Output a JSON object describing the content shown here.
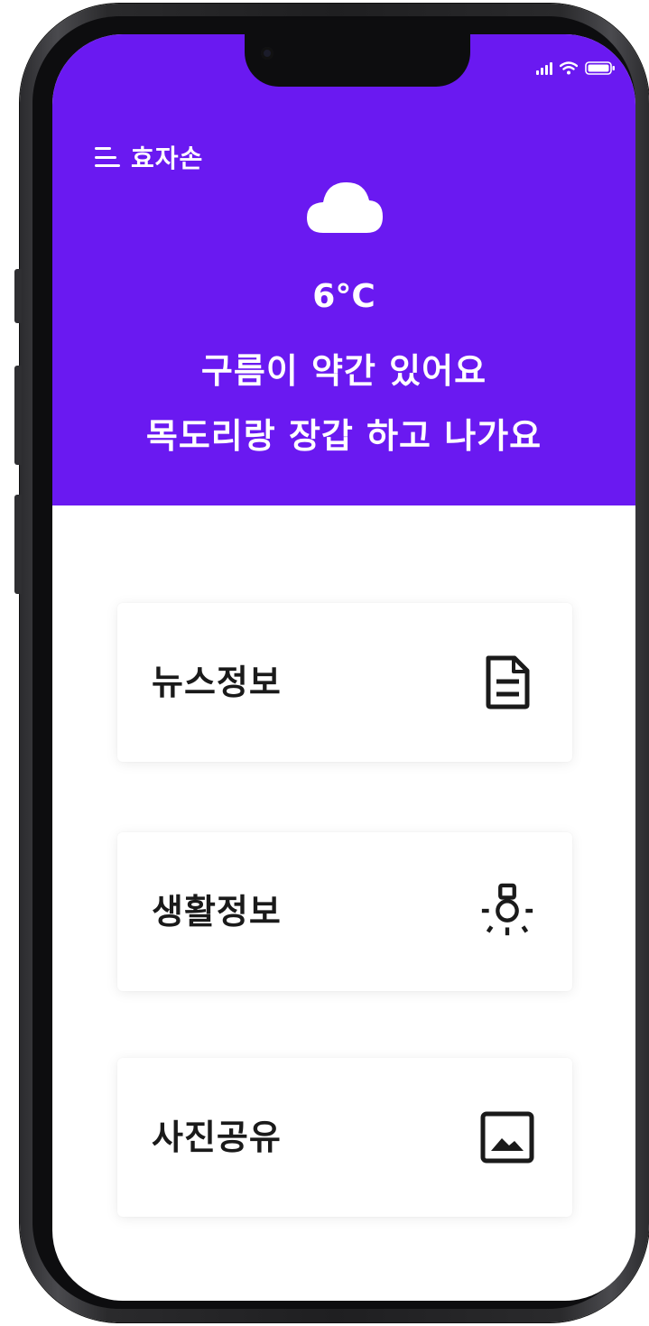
{
  "app": {
    "title": "효자손",
    "accent_color": "#6a19f1"
  },
  "status_bar": {
    "icons": [
      "signal-icon",
      "wifi-icon",
      "battery-icon"
    ]
  },
  "weather": {
    "icon": "cloud-icon",
    "temperature": "6°C",
    "description": "구름이 약간 있어요",
    "advice": "목도리랑 장갑 하고 나가요"
  },
  "menu": {
    "items": [
      {
        "label": "뉴스정보",
        "icon": "document-icon"
      },
      {
        "label": "생활정보",
        "icon": "lightbulb-icon"
      },
      {
        "label": "사진공유",
        "icon": "image-icon"
      }
    ]
  }
}
